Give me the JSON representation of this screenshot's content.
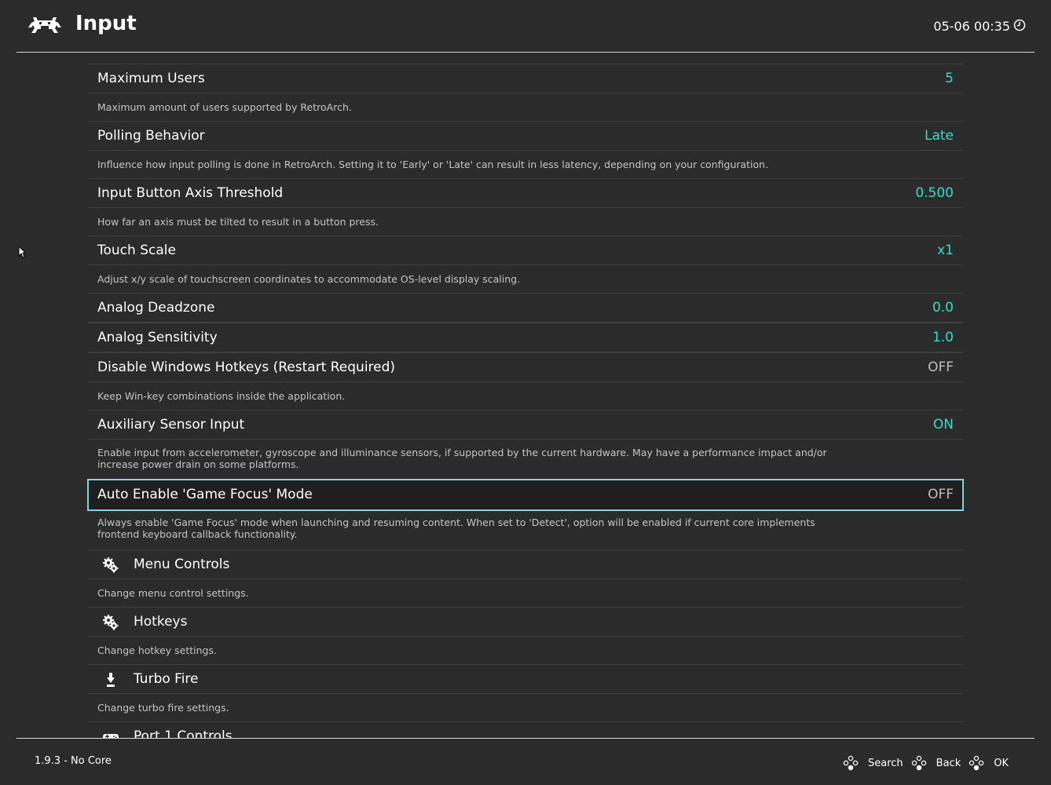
{
  "header": {
    "title": "Input",
    "clock": "05-06 00:35"
  },
  "colors": {
    "accent": "#2fe0c8",
    "off": "#bdbdbd",
    "selected_border": "#7fd3dc"
  },
  "rows": [
    {
      "label": "Maximum Users",
      "value": "5",
      "value_state": "accent",
      "description": "Maximum amount of users supported by RetroArch."
    },
    {
      "label": "Polling Behavior",
      "value": "Late",
      "value_state": "accent",
      "description": "Influence how input polling is done in RetroArch. Setting it to 'Early' or 'Late' can result in less latency, depending on your configuration."
    },
    {
      "label": "Input Button Axis Threshold",
      "value": "0.500",
      "value_state": "accent",
      "description": "How far an axis must be tilted to result in a button press."
    },
    {
      "label": "Touch Scale",
      "value": "x1",
      "value_state": "accent",
      "description": "Adjust x/y scale of touchscreen coordinates to accommodate OS-level display scaling."
    },
    {
      "label": "Analog Deadzone",
      "value": "0.0",
      "value_state": "accent"
    },
    {
      "label": "Analog Sensitivity",
      "value": "1.0",
      "value_state": "accent"
    },
    {
      "label": "Disable Windows Hotkeys (Restart Required)",
      "value": "OFF",
      "value_state": "off",
      "description": "Keep Win-key combinations inside the application."
    },
    {
      "label": "Auxiliary Sensor Input",
      "value": "ON",
      "value_state": "accent",
      "description": "Enable input from accelerometer, gyroscope and illuminance sensors, if supported by the current hardware. May have a performance impact and/or increase power drain on some platforms."
    },
    {
      "label": "Auto Enable 'Game Focus' Mode",
      "value": "OFF",
      "value_state": "off",
      "selected": true,
      "description": "Always enable 'Game Focus' mode when launching and resuming content. When set to 'Detect', option will be enabled if current core implements frontend keyboard callback functionality."
    },
    {
      "label": "Menu Controls",
      "icon": "gears-icon",
      "description": "Change menu control settings."
    },
    {
      "label": "Hotkeys",
      "icon": "gears-icon",
      "description": "Change hotkey settings."
    },
    {
      "label": "Turbo Fire",
      "icon": "turbo-icon",
      "description": "Change turbo fire settings."
    },
    {
      "label": "Port 1 Controls",
      "icon": "gamepad-icon"
    }
  ],
  "footer": {
    "version": "1.9.3 - No Core",
    "buttons": [
      {
        "label": "Search",
        "icon": "gamepad-buttons-icon"
      },
      {
        "label": "Back",
        "icon": "gamepad-buttons-icon"
      },
      {
        "label": "OK",
        "icon": "gamepad-buttons-icon"
      }
    ]
  }
}
